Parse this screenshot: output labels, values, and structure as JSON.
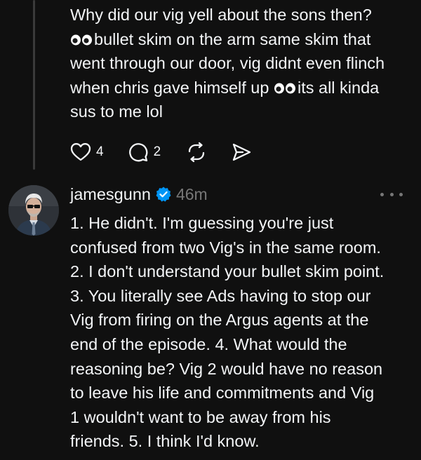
{
  "parent_post": {
    "lines": [
      "Why did our vig yell about the sons then?",
      "bullet skim on the arm same skim that",
      "went through our door, vig didnt even flinch",
      "when chris gave himself up",
      "its all kinda",
      "sus to me lol"
    ],
    "emoji_icon": "eyes-emoji-icon",
    "likes": "4",
    "replies": "2"
  },
  "reply_post": {
    "username": "jamesgunn",
    "verified_icon": "verified-badge-icon",
    "time": "46m",
    "lines": [
      "1. He didn't. I'm guessing you're just",
      "confused from two Vig's in the same room.",
      "2. I don't understand your bullet skim point.",
      "3. You literally see Ads having to stop our",
      "Vig from firing on the Argus agents at the",
      "end of the episode. 4. What would the",
      "reasoning be? Vig 2 would have no reason",
      "to leave his life and commitments and Vig",
      "1 wouldn't want to be away from his",
      "friends. 5. I think I'd know."
    ]
  },
  "icons": {
    "like": "heart-icon",
    "reply": "comment-icon",
    "repost": "repost-icon",
    "share": "send-icon",
    "more": "more-options-icon"
  },
  "colors": {
    "background": "#101010",
    "text": "#f3f5f7",
    "muted": "#777777",
    "verified": "#0095f6",
    "thread_line": "#3a3a3a"
  }
}
